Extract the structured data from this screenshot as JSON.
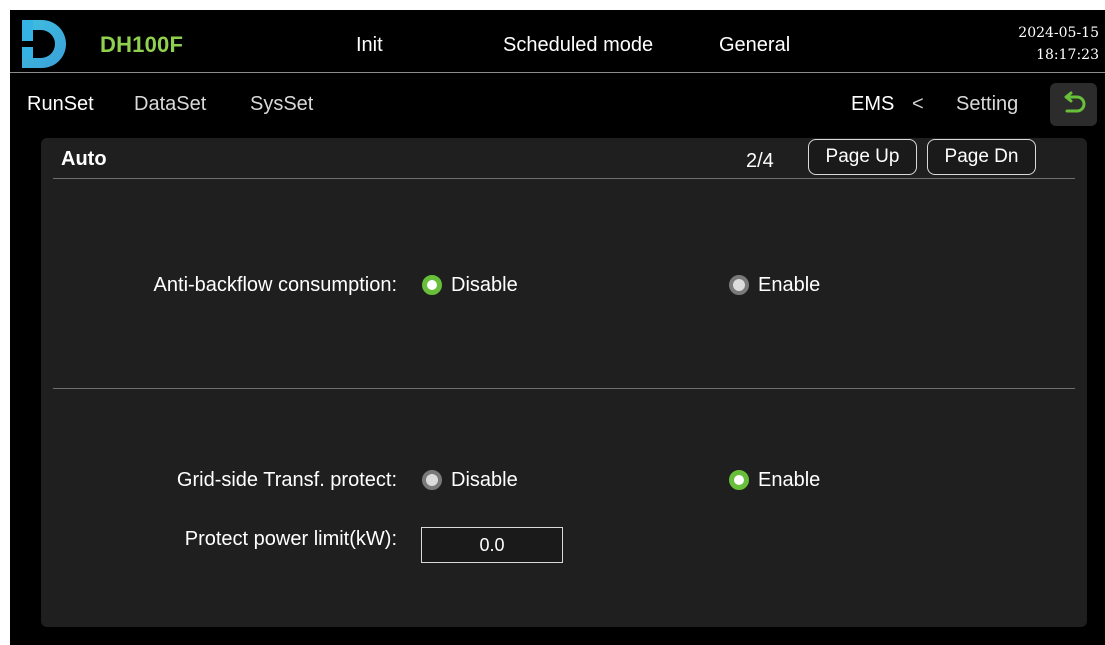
{
  "header": {
    "device_name": "DH100F",
    "nav": [
      "Init",
      "Scheduled mode",
      "General"
    ],
    "date": "2024-05-15",
    "time": "18:17:23"
  },
  "subnav": {
    "tabs": [
      "RunSet",
      "DataSet",
      "SysSet"
    ],
    "breadcrumb": {
      "current": "EMS",
      "separator": "<",
      "parent": "Setting"
    }
  },
  "panel": {
    "title": "Auto",
    "page_indicator": "2/4",
    "page_up_label": "Page Up",
    "page_down_label": "Page Dn",
    "settings": {
      "anti_backflow": {
        "label": "Anti-backflow consumption:",
        "options": [
          "Disable",
          "Enable"
        ],
        "selected": "Disable"
      },
      "grid_transf_protect": {
        "label": "Grid-side Transf. protect:",
        "options": [
          "Disable",
          "Enable"
        ],
        "selected": "Enable"
      },
      "protect_power_limit": {
        "label": "Protect power limit(kW):",
        "value": "0.0"
      }
    }
  },
  "colors": {
    "accent_green": "#67bf3a",
    "brand_green": "#8fd14f",
    "background": "#000000",
    "panel": "#1f1f1f"
  },
  "icons": {
    "logo": "d-logo",
    "back": "back-arrow-icon"
  }
}
